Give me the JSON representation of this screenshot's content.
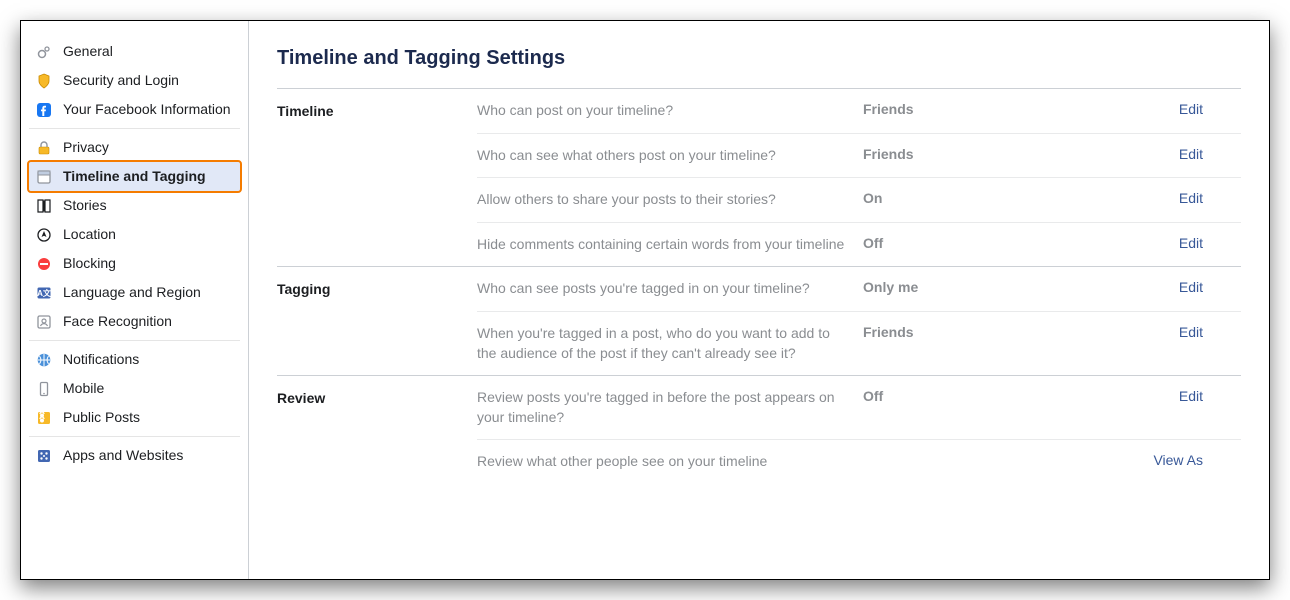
{
  "page": {
    "title": "Timeline and Tagging Settings",
    "edit_label": "Edit",
    "viewas_label": "View As"
  },
  "sidebar": {
    "groups": [
      [
        {
          "id": "general",
          "label": "General"
        },
        {
          "id": "security",
          "label": "Security and Login"
        },
        {
          "id": "yourinfo",
          "label": "Your Facebook Information"
        }
      ],
      [
        {
          "id": "privacy",
          "label": "Privacy"
        },
        {
          "id": "timeline",
          "label": "Timeline and Tagging",
          "active": true
        },
        {
          "id": "stories",
          "label": "Stories"
        },
        {
          "id": "location",
          "label": "Location"
        },
        {
          "id": "blocking",
          "label": "Blocking"
        },
        {
          "id": "language",
          "label": "Language and Region"
        },
        {
          "id": "face",
          "label": "Face Recognition"
        }
      ],
      [
        {
          "id": "notifications",
          "label": "Notifications"
        },
        {
          "id": "mobile",
          "label": "Mobile"
        },
        {
          "id": "public",
          "label": "Public Posts"
        }
      ],
      [
        {
          "id": "apps",
          "label": "Apps and Websites"
        }
      ]
    ]
  },
  "sections": [
    {
      "label": "Timeline",
      "rows": [
        {
          "desc": "Who can post on your timeline?",
          "value": "Friends",
          "action": "edit"
        },
        {
          "desc": "Who can see what others post on your timeline?",
          "value": "Friends",
          "action": "edit"
        },
        {
          "desc": "Allow others to share your posts to their stories?",
          "value": "On",
          "action": "edit"
        },
        {
          "desc": "Hide comments containing certain words from your timeline",
          "value": "Off",
          "action": "edit"
        }
      ]
    },
    {
      "label": "Tagging",
      "rows": [
        {
          "desc": "Who can see posts you're tagged in on your timeline?",
          "value": "Only me",
          "action": "edit"
        },
        {
          "desc": "When you're tagged in a post, who do you want to add to the audience of the post if they can't already see it?",
          "value": "Friends",
          "action": "edit"
        }
      ]
    },
    {
      "label": "Review",
      "rows": [
        {
          "desc": "Review posts you're tagged in before the post appears on your timeline?",
          "value": "Off",
          "action": "edit"
        },
        {
          "desc": "Review what other people see on your timeline",
          "value": "",
          "action": "viewas"
        }
      ]
    }
  ]
}
